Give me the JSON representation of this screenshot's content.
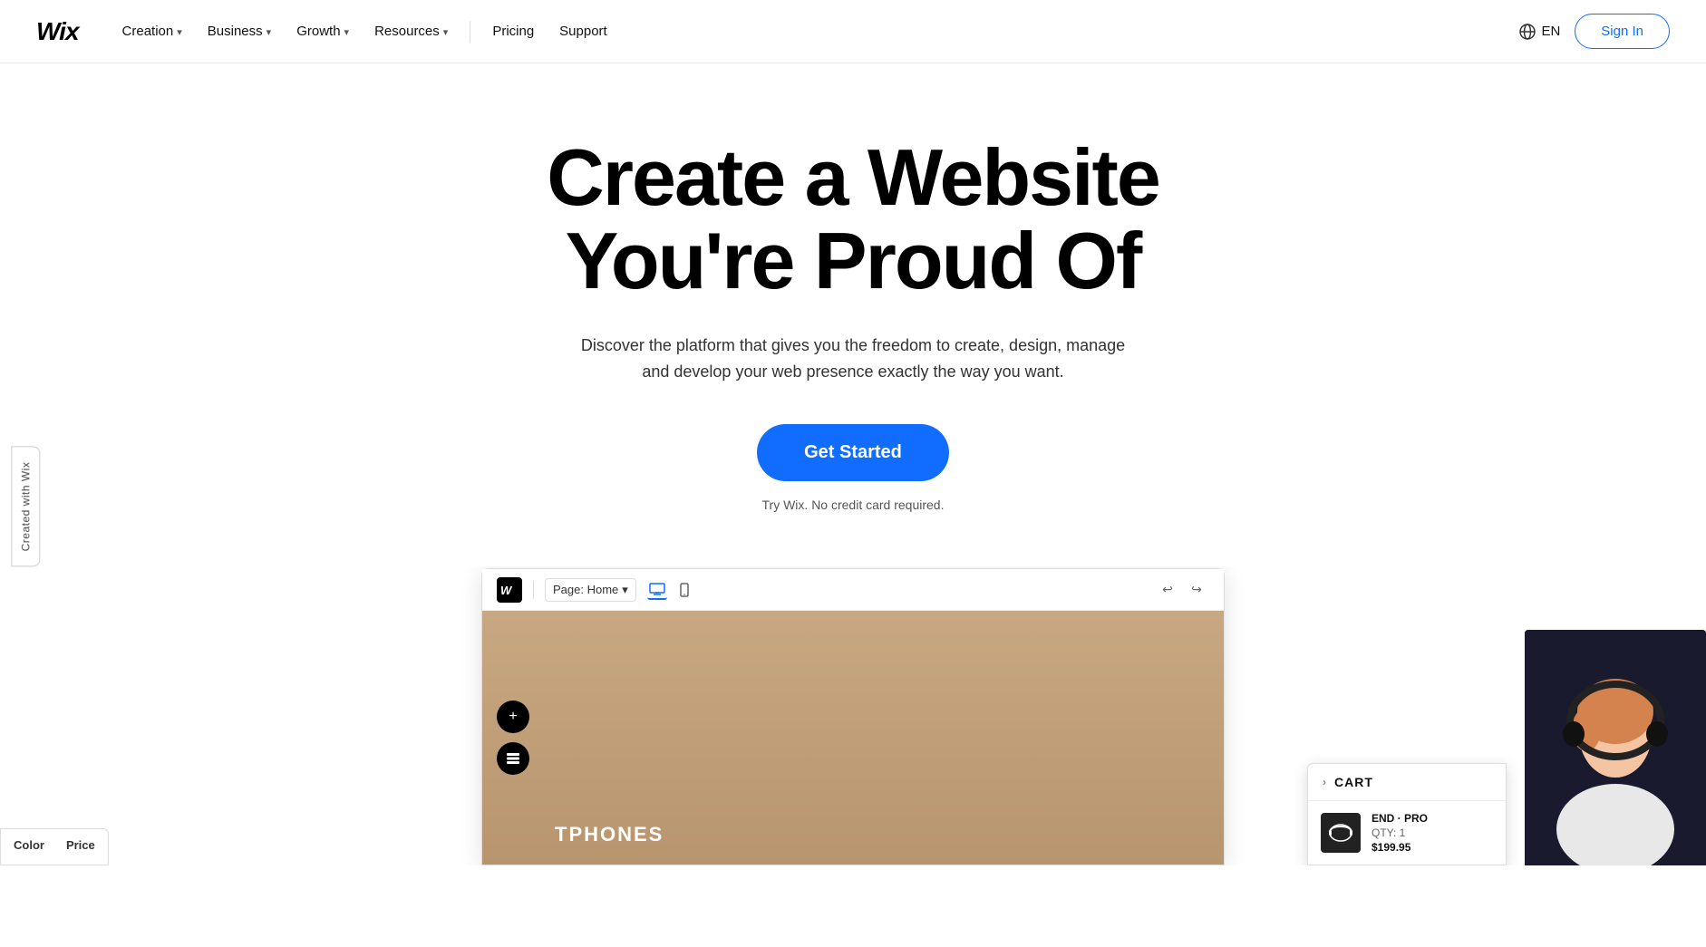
{
  "nav": {
    "logo": "Wix",
    "links": [
      {
        "label": "Creation",
        "hasDropdown": true
      },
      {
        "label": "Business",
        "hasDropdown": true
      },
      {
        "label": "Growth",
        "hasDropdown": true
      },
      {
        "label": "Resources",
        "hasDropdown": true
      }
    ],
    "plainLinks": [
      {
        "label": "Pricing"
      },
      {
        "label": "Support"
      }
    ],
    "lang": "EN",
    "signIn": "Sign In"
  },
  "hero": {
    "title": "Create a Website\nYou're Proud Of",
    "subtitle": "Discover the platform that gives you the freedom to create, design, manage and develop your web presence exactly the way you want.",
    "cta": "Get Started",
    "noCc": "Try Wix. No credit card required."
  },
  "sideBadge": "Created with Wix",
  "editor": {
    "pageSelectorLabel": "Page: Home",
    "logoChar": "W"
  },
  "cart": {
    "header": "CART",
    "chevron": "›",
    "item": {
      "name": "END · PRO",
      "qty": "QTY: 1",
      "price": "$199.95"
    }
  },
  "colorPrice": {
    "colorHeader": "Color",
    "priceHeader": "Price"
  },
  "canvas": {
    "brand": "TPHONES"
  }
}
